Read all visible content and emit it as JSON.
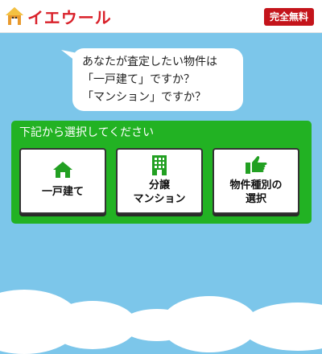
{
  "header": {
    "logo_text": "イエウール",
    "badge_label": "完全無料"
  },
  "bubble": {
    "line1": "あなたが査定したい物件は",
    "line2": "「一戸建て」ですか？",
    "line3": "「マンション」ですか？"
  },
  "panel": {
    "title": "下記から選択してください",
    "cards": [
      {
        "label": "一戸建て",
        "icon": "house-icon"
      },
      {
        "label": "分譲\nマンション",
        "icon": "building-icon"
      },
      {
        "label": "物件種別の\n選択",
        "icon": "pointing-hand-icon"
      }
    ]
  },
  "colors": {
    "brand_red": "#d9212a",
    "panel_green": "#22b223",
    "sky_blue": "#7cc6ea"
  }
}
